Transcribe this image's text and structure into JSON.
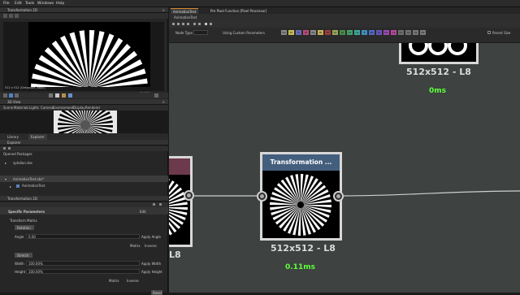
{
  "menu": [
    "File",
    "Edit",
    "Tools",
    "Windows",
    "Help"
  ],
  "viewer2d": {
    "title": "Transformation 2D",
    "status": "512 x 512 (Greyscale, 8bpc)",
    "zoom": "65.70%"
  },
  "viewer3d": {
    "title": "3D View",
    "menu": [
      "Scene",
      "Materials",
      "Lights",
      "Camera",
      "Environment",
      "Display",
      "Renderer"
    ]
  },
  "explorer": {
    "tabs": [
      "Library",
      "Explorer"
    ],
    "title": "Explorer",
    "section": "Opened Packages",
    "items": [
      "sptallon.sbs",
      "AnimationTest.sbs*",
      "AnimationTest"
    ]
  },
  "params": {
    "title": "Transformation 2D",
    "section": "Specific Parameters",
    "subsection": "Transform Matrix",
    "rotation_label": "Rotation",
    "angle_label": "Angle",
    "angle_value": "0.00",
    "angle_apply": "Apply Angle",
    "stretch_label": "Stretch",
    "width_label": "Width",
    "width_value": "100.00%",
    "width_apply": "Apply Width",
    "height_label": "Height",
    "height_value": "100.00%",
    "height_apply": "Apply Height",
    "matrix_labels": [
      "Matrix",
      "Inverse"
    ],
    "reset": "Reset"
  },
  "graph": {
    "tabs": [
      "AnimationTest",
      "Pre Pixel Function [Pixel Processor]"
    ],
    "title": "AnimationTest",
    "node_type": "Node Type",
    "using_custom": "Using Custom Parameters",
    "parent_size": "Parent Size",
    "chips": [
      {
        "label": "Bg",
        "color": "#8a8a8a"
      },
      {
        "label": "Bc",
        "color": "#c6c058"
      },
      {
        "label": "N",
        "color": "#6b6bb5"
      },
      {
        "label": "Ht",
        "color": "#b64d7a"
      },
      {
        "label": "Rg",
        "color": "#8a8a8a"
      },
      {
        "label": "Mt",
        "color": "#c9b25a"
      },
      {
        "label": "Rf",
        "color": "#9c3f3f"
      },
      {
        "label": "Sp",
        "color": "#9aa856"
      },
      {
        "label": "Gl",
        "color": "#4b8a4b"
      },
      {
        "label": "Ao",
        "color": "#45a06a"
      },
      {
        "label": "Hg",
        "color": "#43a99e"
      },
      {
        "label": "Tr",
        "color": "#3f8ebd"
      },
      {
        "label": "Ds",
        "color": "#4c6cbf"
      },
      {
        "label": "Sc",
        "color": "#6a54b8"
      },
      {
        "label": "Em",
        "color": "#9b4bb3"
      },
      {
        "label": "Op",
        "color": "#b74a9b"
      },
      {
        "label": "An",
        "color": "#6e6e6e"
      },
      {
        "label": "Ap",
        "color": "#717171"
      },
      {
        "label": "Us",
        "color": "#777777"
      },
      {
        "label": "Mk",
        "color": "#7c7c7c"
      }
    ],
    "nodes": [
      {
        "size": "512x512 - L8",
        "timing": "0ms"
      },
      {
        "title": "Transformation ...",
        "size": "512x512 - L8",
        "timing": "0.11ms"
      },
      {
        "size": "L8"
      }
    ]
  },
  "colors": {
    "accent": "#3e66a8",
    "timing": "#5dff3c",
    "node_header": "#445e7e",
    "graph_bg": "#3e4240"
  }
}
